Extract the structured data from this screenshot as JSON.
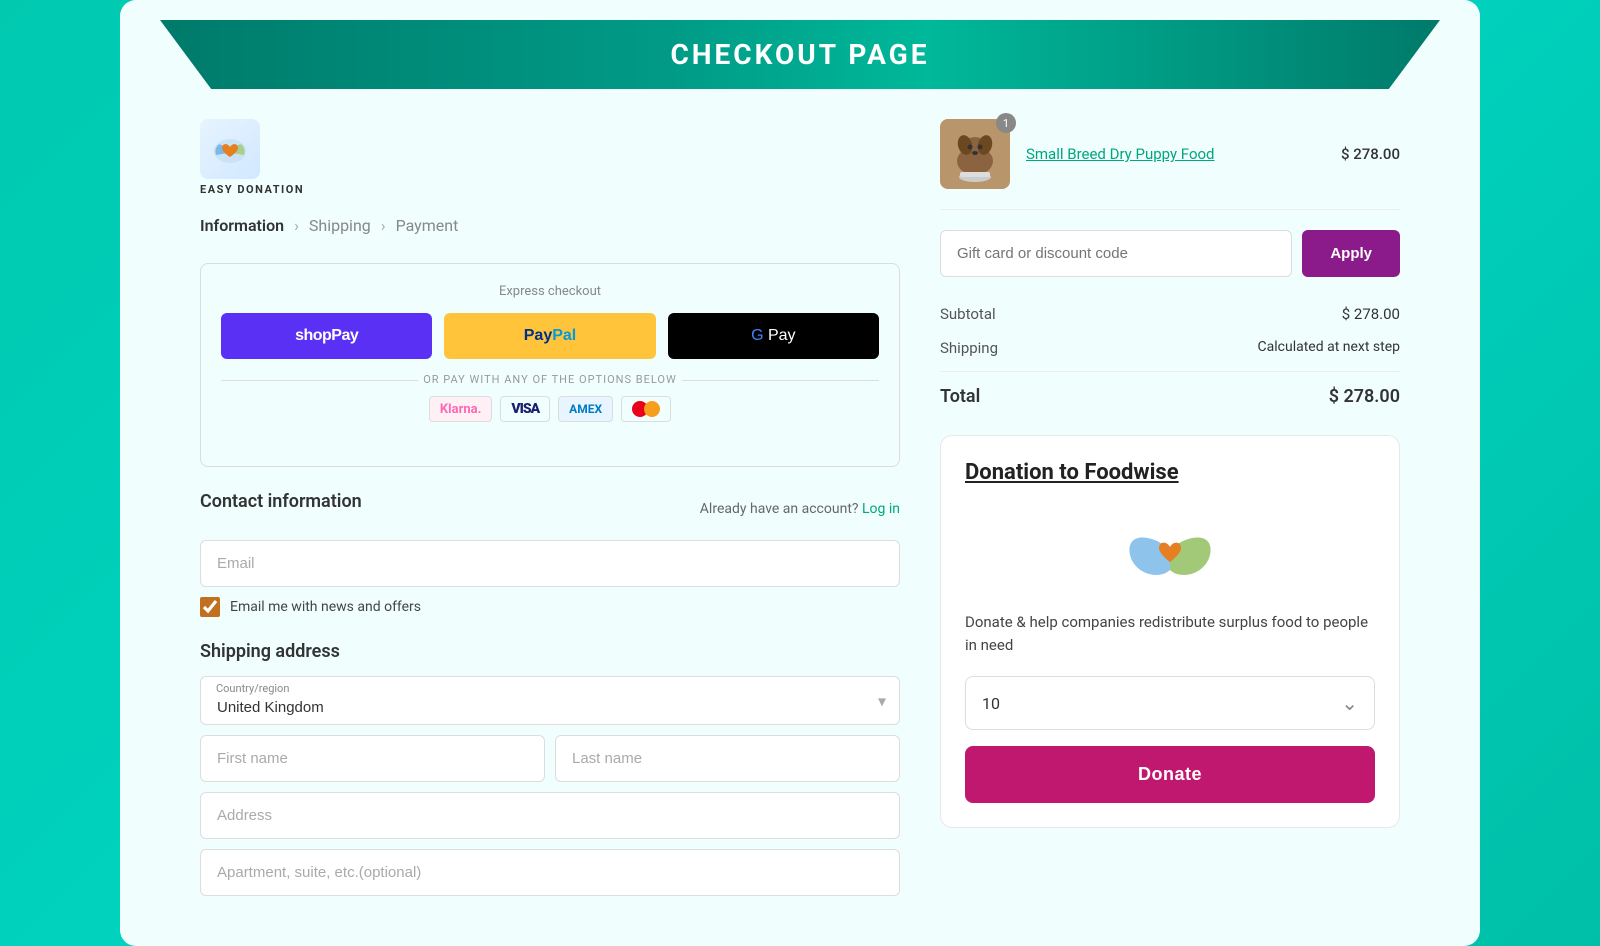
{
  "page": {
    "title": "CHECKOUT PAGE"
  },
  "logo": {
    "text": "EASY DONATION",
    "icon_emoji": "🤲"
  },
  "breadcrumb": {
    "steps": [
      "Information",
      "Shipping",
      "Payment"
    ],
    "active": "Information"
  },
  "express": {
    "label": "Express checkout",
    "or_text": "OR PAY WITH ANY OF THE OPTIONS BELOW",
    "shoppay_label": "shop Pay",
    "paypal_label": "PayPal",
    "gpay_label": "G Pay"
  },
  "contact": {
    "title": "Contact information",
    "already_account": "Already have an account?",
    "login_label": "Log in",
    "email_placeholder": "Email",
    "newsletter_label": "Email me with news and offers"
  },
  "shipping": {
    "title": "Shipping address",
    "country_label": "Country/region",
    "country_value": "United Kingdom",
    "first_name_placeholder": "First name",
    "last_name_placeholder": "Last name",
    "address_placeholder": "Address",
    "apt_placeholder": "Apartment, suite, etc.(optional)"
  },
  "order": {
    "product_name": "Small Breed Dry Puppy Food",
    "product_price": "$ 278.00",
    "product_badge": "1",
    "discount_placeholder": "Gift card or discount code",
    "apply_label": "Apply",
    "subtotal_label": "Subtotal",
    "subtotal_value": "$ 278.00",
    "shipping_label": "Shipping",
    "shipping_value": "Calculated at next step",
    "total_label": "Total",
    "total_value": "$ 278.00"
  },
  "donation": {
    "title": "Donation to Foodwise",
    "description": "Donate & help companies redistribute surplus food to people in need",
    "amount": "10",
    "donate_label": "Donate"
  }
}
